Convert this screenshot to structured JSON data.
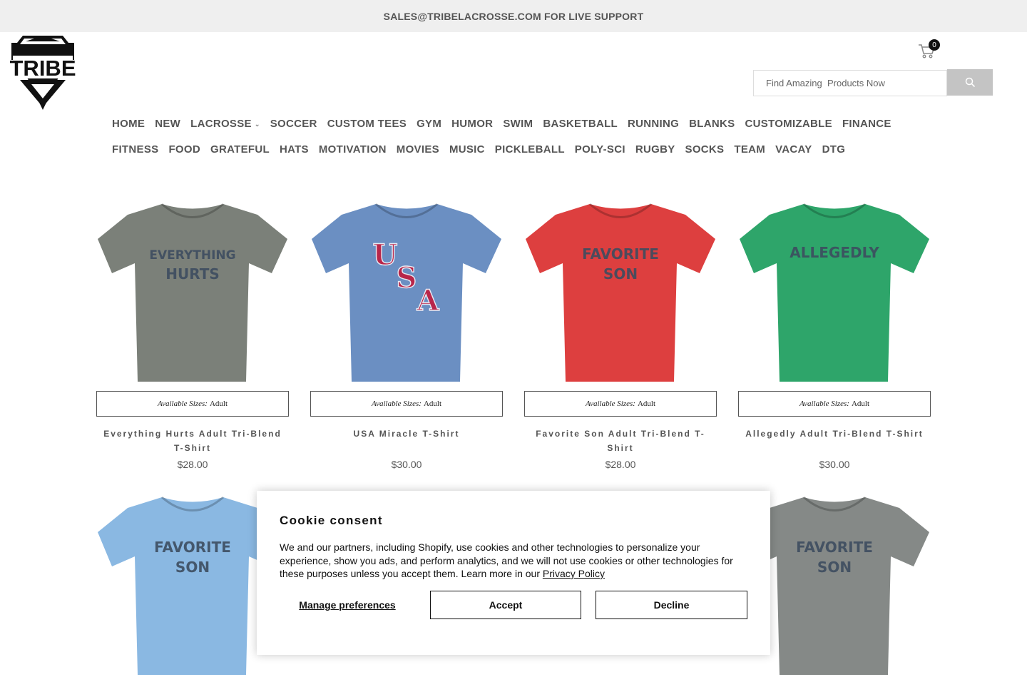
{
  "announcement": "SALES@TRIBELACROSSE.COM FOR LIVE SUPPORT",
  "logo": {
    "text": "TRIBE"
  },
  "cart": {
    "count": "0",
    "icon": "cart-icon"
  },
  "search": {
    "placeholder": "Find Amazing  Products Now",
    "icon": "search-icon"
  },
  "nav": {
    "row1": [
      "HOME",
      "NEW",
      "LACROSSE",
      "SOCCER",
      "CUSTOM TEES",
      "GYM",
      "HUMOR",
      "SWIM",
      "BASKETBALL",
      "RUNNING",
      "BLANKS",
      "CUSTOMIZABLE",
      "FINANCE"
    ],
    "row2": [
      "FITNESS",
      "FOOD",
      "GRATEFUL",
      "HATS",
      "MOTIVATION",
      "MOVIES",
      "MUSIC",
      "PICKLEBALL",
      "POLY-SCI",
      "RUGBY",
      "SOCKS",
      "TEAM",
      "VACAY",
      "DTG"
    ]
  },
  "products": [
    {
      "name": "Everything Hurts Adult Tri-Blend T-Shirt",
      "price": "$28.00",
      "sizes_label": "Available Sizes:",
      "sizes": "Adult",
      "shirt_color": "#7b8079",
      "print_color": "#3d4d60",
      "print": [
        "EVERYTHING",
        "HURTS"
      ]
    },
    {
      "name": "USA Miracle T-Shirt",
      "price": "$30.00",
      "sizes_label": "Available Sizes:",
      "sizes": "Adult",
      "shirt_color": "#6b8fc2",
      "print_color": "#b8264a",
      "print": [
        "U",
        "S",
        "A"
      ]
    },
    {
      "name": "Favorite Son Adult Tri-Blend T-Shirt",
      "price": "$28.00",
      "sizes_label": "Available Sizes:",
      "sizes": "Adult",
      "shirt_color": "#dd3f3f",
      "print_color": "#3d4d60",
      "print": [
        "FAVORITE",
        "SON"
      ]
    },
    {
      "name": "Allegedly Adult Tri-Blend T-Shirt",
      "price": "$30.00",
      "sizes_label": "Available Sizes:",
      "sizes": "Adult",
      "shirt_color": "#2ea56a",
      "print_color": "#3d4d60",
      "print": [
        "ALLEGEDLY"
      ]
    },
    {
      "shirt_color": "#8ab8e2",
      "print_color": "#3d4d60",
      "print": [
        "FAVORITE",
        "SON"
      ]
    },
    {
      "shirt_color": "#858987",
      "print_color": "#3d4d60",
      "print": [
        "FAVORITE",
        "SON"
      ]
    }
  ],
  "cookie": {
    "title": "Cookie consent",
    "body": "We and our partners, including Shopify, use cookies and other technologies to personalize your experience, show you ads, and perform analytics, and we will not use cookies or other technologies for these purposes unless you accept them. Learn more in our ",
    "link": "Privacy Policy",
    "manage": "Manage preferences",
    "accept": "Accept",
    "decline": "Decline"
  }
}
